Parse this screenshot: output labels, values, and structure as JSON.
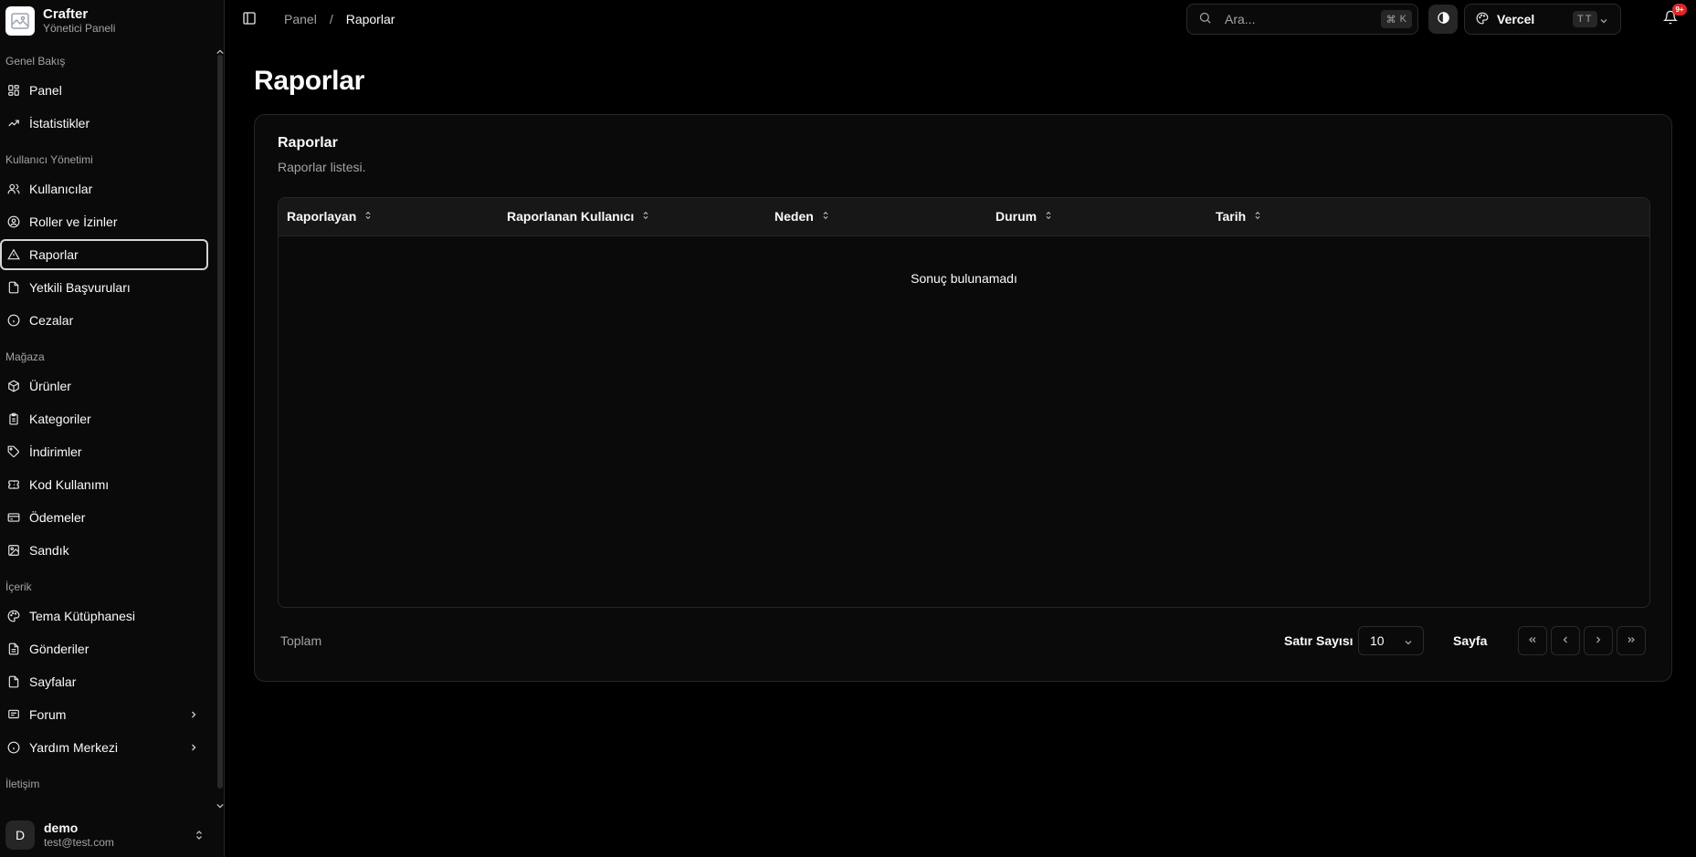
{
  "brand": {
    "title": "Crafter",
    "subtitle": "Yönetici Paneli"
  },
  "sidebar": {
    "sections": [
      {
        "label": "Genel Bakış"
      },
      {
        "label": "Kullanıcı Yönetimi"
      },
      {
        "label": "Mağaza"
      },
      {
        "label": "İçerik"
      },
      {
        "label": "İletişim"
      }
    ],
    "items": [
      {
        "label": "Panel",
        "icon": "dashboard-icon"
      },
      {
        "label": "İstatistikler",
        "icon": "trending-up-icon"
      },
      {
        "label": "Kullanıcılar",
        "icon": "users-icon"
      },
      {
        "label": "Roller ve İzinler",
        "icon": "user-circle-icon"
      },
      {
        "label": "Raporlar",
        "icon": "alert-triangle-icon",
        "active": true
      },
      {
        "label": "Yetkili Başvuruları",
        "icon": "file-icon"
      },
      {
        "label": "Cezalar",
        "icon": "info-circle-icon"
      },
      {
        "label": "Ürünler",
        "icon": "package-icon"
      },
      {
        "label": "Kategoriler",
        "icon": "clipboard-icon"
      },
      {
        "label": "İndirimler",
        "icon": "tag-icon"
      },
      {
        "label": "Kod Kullanımı",
        "icon": "ticket-icon"
      },
      {
        "label": "Ödemeler",
        "icon": "credit-card-icon"
      },
      {
        "label": "Sandık",
        "icon": "image-icon"
      },
      {
        "label": "Tema Kütüphanesi",
        "icon": "palette-icon"
      },
      {
        "label": "Gönderiler",
        "icon": "file-text-icon"
      },
      {
        "label": "Sayfalar",
        "icon": "file-icon"
      },
      {
        "label": "Forum",
        "icon": "message-square-icon",
        "expandable": true
      },
      {
        "label": "Yardım Merkezi",
        "icon": "info-circle-icon",
        "expandable": true
      }
    ]
  },
  "user": {
    "initial": "D",
    "name": "demo",
    "email": "test@test.com"
  },
  "header": {
    "breadcrumb": {
      "parent": "Panel",
      "separator": "/",
      "current": "Raporlar"
    },
    "search": {
      "placeholder": "Ara...",
      "shortcut_symbol": "⌘",
      "shortcut_key": "K"
    },
    "team": {
      "name": "Vercel",
      "shortcut": "TT"
    },
    "notifications_badge": "9+"
  },
  "main": {
    "page_title": "Raporlar",
    "card": {
      "title": "Raporlar",
      "description": "Raporlar listesi.",
      "columns": [
        "Raporlayan",
        "Raporlanan Kullanıcı",
        "Neden",
        "Durum",
        "Tarih"
      ],
      "empty_text": "Sonuç bulunamadı"
    },
    "footer": {
      "total_label": "Toplam",
      "rows_label": "Satır Sayısı",
      "rows_value": "10",
      "page_label": "Sayfa"
    }
  }
}
